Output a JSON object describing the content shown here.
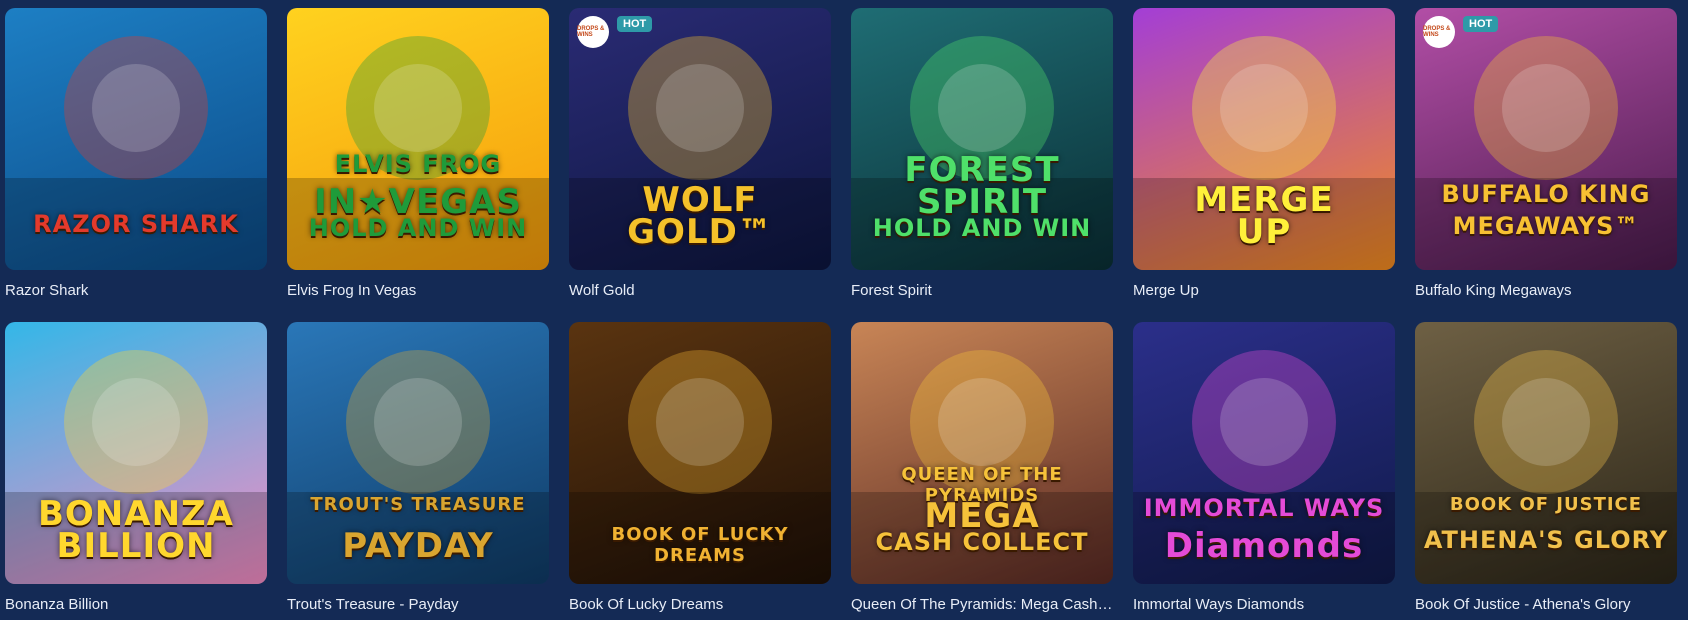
{
  "games": [
    {
      "title": "Razor Shark",
      "logo": [
        "RAZOR SHARK"
      ],
      "hot": false,
      "bg": [
        "#1d7fc4",
        "#0c4a86"
      ],
      "accent": "#e33a2c",
      "icon": "shark-art"
    },
    {
      "title": "Elvis Frog In Vegas",
      "logo": [
        "ELVIS FROG",
        "IN★VEGAS",
        "HOLD AND WIN"
      ],
      "hot": false,
      "bg": [
        "#ffd21f",
        "#f59b0b"
      ],
      "accent": "#1f9b3a",
      "icon": "frog-art"
    },
    {
      "title": "Wolf Gold",
      "logo": [
        "WOLF",
        "GOLD™"
      ],
      "hot": true,
      "bg": [
        "#2a2b74",
        "#0d1640"
      ],
      "accent": "#f4c12a",
      "icon": "wolf-art"
    },
    {
      "title": "Forest Spirit",
      "logo": [
        "FOREST",
        "SPIRIT",
        "HOLD AND WIN"
      ],
      "hot": false,
      "bg": [
        "#1f6d74",
        "#0a2f36"
      ],
      "accent": "#4fe06a",
      "icon": "bear-art"
    },
    {
      "title": "Merge Up",
      "logo": [
        "MERGE",
        "UP"
      ],
      "hot": false,
      "bg": [
        "#a33ed6",
        "#f38c1f"
      ],
      "accent": "#fff03a",
      "icon": "gem-art"
    },
    {
      "title": "Buffalo King Megaways",
      "logo": [
        "BUFFALO KING",
        "MEGAWAYS™"
      ],
      "hot": true,
      "bg": [
        "#b24ea6",
        "#4a1b4c"
      ],
      "accent": "#f7c133",
      "icon": "buffalo-art"
    },
    {
      "title": "Bonanza Billion",
      "logo": [
        "BONANZA",
        "BILLION"
      ],
      "hot": false,
      "bg": [
        "#33b7e8",
        "#f58dc4"
      ],
      "accent": "#ffd72e",
      "icon": "candy-art"
    },
    {
      "title": "Trout's Treasure - Payday",
      "logo": [
        "TROUT'S TREASURE",
        "PAYDAY"
      ],
      "hot": false,
      "bg": [
        "#2a77b8",
        "#0f3b66"
      ],
      "accent": "#d9a530",
      "icon": "fisherman-art"
    },
    {
      "title": "Book Of Lucky Dreams",
      "logo": [
        "BOOK OF LUCKY DREAMS"
      ],
      "hot": false,
      "bg": [
        "#5a3410",
        "#1f1006"
      ],
      "accent": "#f0b232",
      "icon": "book-art"
    },
    {
      "title": "Queen Of The Pyramids: Mega Cash Collect",
      "logo": [
        "QUEEN OF THE PYRAMIDS",
        "MEGA",
        "CASH COLLECT"
      ],
      "hot": false,
      "bg": [
        "#c88556",
        "#5a2a24"
      ],
      "accent": "#f6c23a",
      "icon": "queen-art"
    },
    {
      "title": "Immortal Ways Diamonds",
      "logo": [
        "IMMORTAL WAYS",
        "Diamonds"
      ],
      "hot": false,
      "bg": [
        "#2b2f8a",
        "#101a4a"
      ],
      "accent": "#e44bd7",
      "icon": "sevens-art"
    },
    {
      "title": "Book Of Justice - Athena's Glory",
      "logo": [
        "BOOK OF JUSTICE",
        "ATHENA'S GLORY"
      ],
      "hot": false,
      "bg": [
        "#6e6044",
        "#2c2618"
      ],
      "accent": "#f1c04b",
      "icon": "athena-art"
    }
  ],
  "hot_label": "HOT",
  "provider_badge": "DROPS & WINS"
}
